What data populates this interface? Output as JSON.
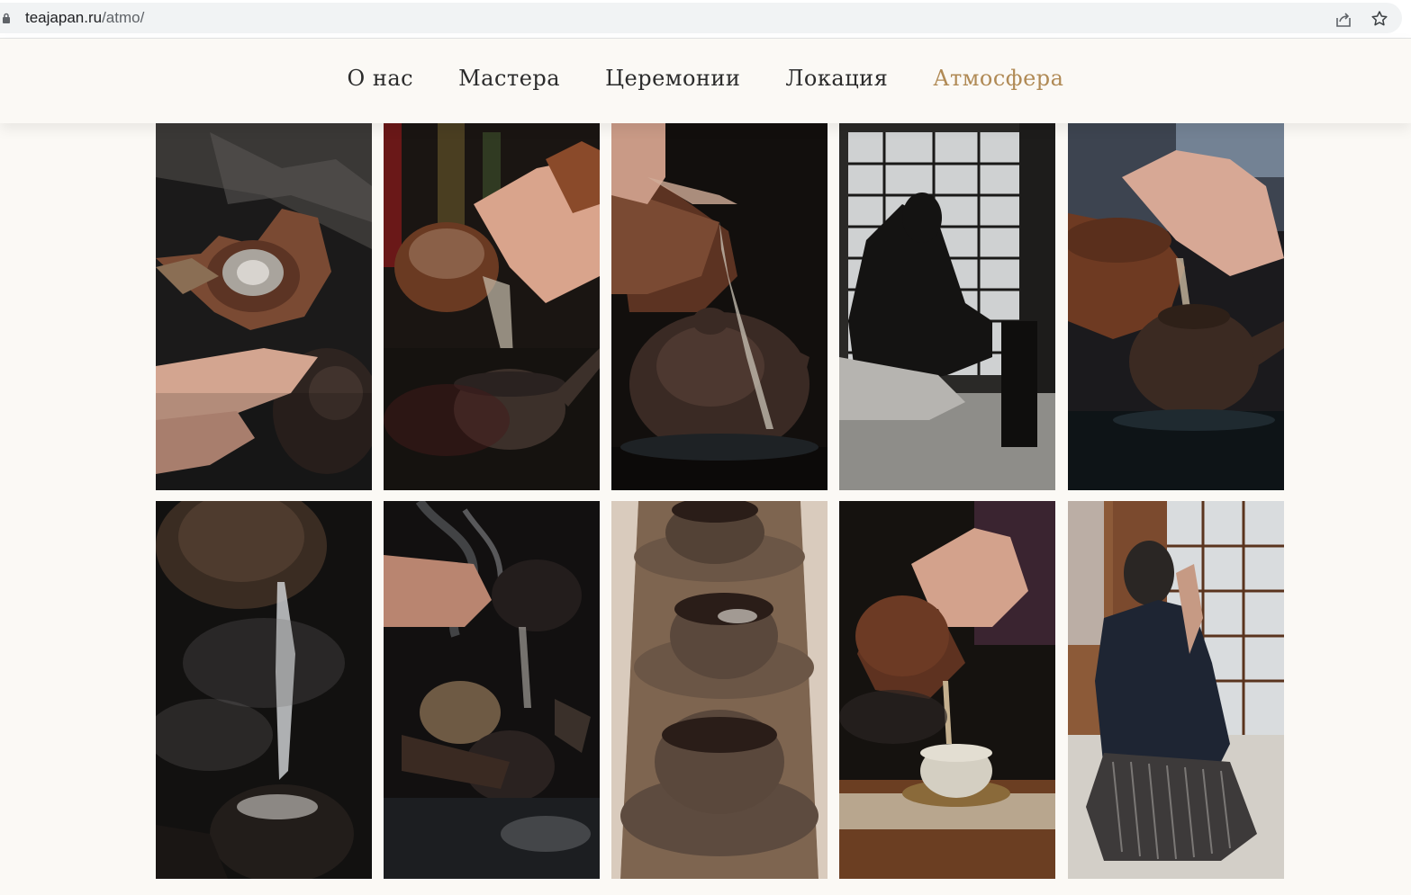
{
  "browser": {
    "url_domain": "teajapan.ru",
    "url_path": "/atmo/"
  },
  "nav": {
    "items": [
      {
        "label": "О нас"
      },
      {
        "label": "Мастера"
      },
      {
        "label": "Церемонии"
      },
      {
        "label": "Локация"
      },
      {
        "label": "Атмосфера"
      }
    ],
    "active_index": 4
  },
  "colors": {
    "page_bg": "#fbf9f5",
    "nav_text": "#2b2b2b",
    "nav_active": "#b08a55"
  },
  "gallery": {
    "photos": [
      {
        "subject": "clay pitcher over teapot"
      },
      {
        "subject": "pouring water into kyusu"
      },
      {
        "subject": "water pouring over teapot"
      },
      {
        "subject": "silhouette of master by shoji window"
      },
      {
        "subject": "pouring into teapot"
      },
      {
        "subject": "water pouring with steam"
      },
      {
        "subject": "smoking kettle and tea tools"
      },
      {
        "subject": "three tea cups on runner"
      },
      {
        "subject": "pouring tea into cup"
      },
      {
        "subject": "man drinking tea in kimono"
      }
    ]
  }
}
